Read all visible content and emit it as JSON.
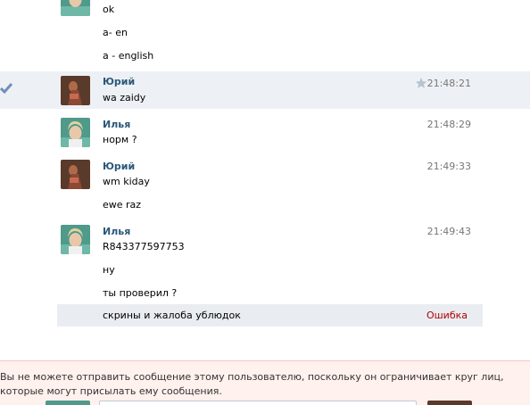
{
  "messages": {
    "top_lines": [
      "ok",
      "a- en",
      "a - english"
    ],
    "m1": {
      "author": "Юрий",
      "text": "wa zaidy",
      "time": "21:48:21"
    },
    "m2": {
      "author": "Илья",
      "text": "норм ?",
      "time": "21:48:29"
    },
    "m3": {
      "author": "Юрий",
      "lines": [
        "wm kiday",
        "ewe raz"
      ],
      "time": "21:49:33"
    },
    "m4": {
      "author": "Илья",
      "lines": [
        "R843377597753",
        "ну",
        "ты проверил ?"
      ],
      "time": "21:49:43"
    },
    "failed": {
      "text": "скрины и жалоба ублюдок",
      "status": "Ошибка"
    }
  },
  "restriction": {
    "text": "Вы не можете отправить сообщение этому пользователю, поскольку он ограничивает круг лиц, которые могут присылать ему сообщения."
  },
  "colors": {
    "author_name": "#2b587a",
    "highlight_row": "#edf1f5",
    "error": "#b00000",
    "restriction_bg": "#fff1ee"
  },
  "icons": [
    "check-icon",
    "star-icon"
  ]
}
